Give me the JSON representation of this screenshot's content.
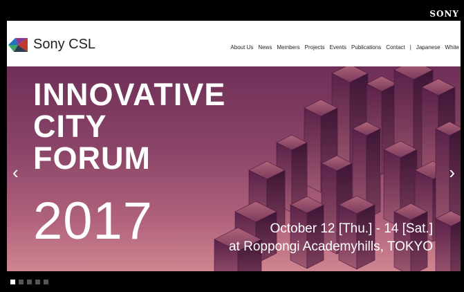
{
  "topbar": {
    "brand_logo": "SONY"
  },
  "header": {
    "brand_name": "Sony CSL",
    "nav": [
      "About Us",
      "News",
      "Members",
      "Projects",
      "Events",
      "Publications",
      "Contact",
      "|",
      "Japanese",
      "White"
    ]
  },
  "hero": {
    "title_lines": [
      "INNOVATIVE",
      "CITY",
      "FORUM"
    ],
    "year": "2017",
    "date_line": "October 12 [Thu.] - 14 [Sat.]",
    "venue_line": "at Roppongi Academyhills, TOKYO",
    "prev_arrow": "‹",
    "next_arrow": "›"
  },
  "carousel": {
    "slide_count": 5,
    "active_index": 0
  },
  "colors": {
    "hero_top": "#6e2f57",
    "hero_bottom": "#cf8590",
    "brand_blue": "#1e73be",
    "brand_green": "#3aa66b",
    "brand_purple": "#8b3a8f"
  }
}
